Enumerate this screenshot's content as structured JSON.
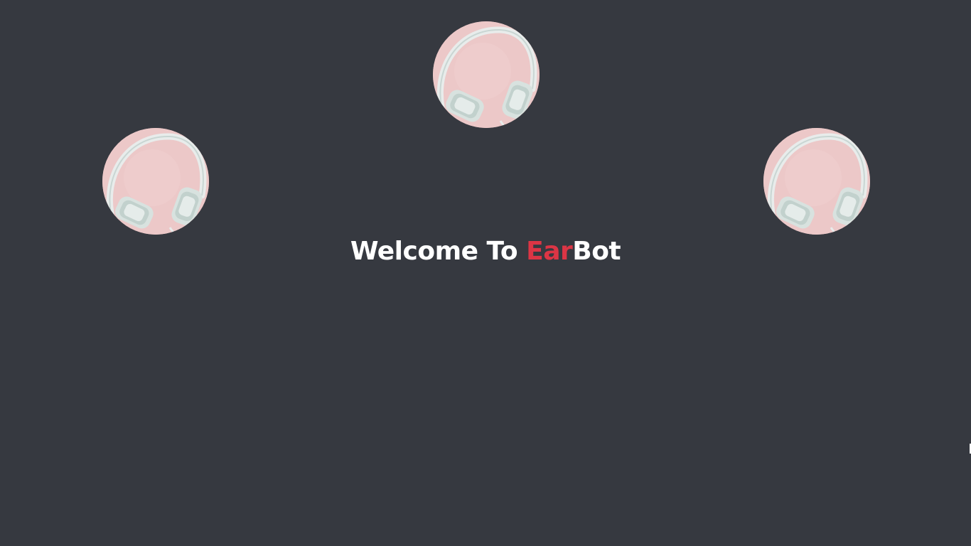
{
  "welcome": {
    "prefix": "Welcome To ",
    "brand_accent": "Ear",
    "brand_rest": "Bot"
  },
  "images": [
    {
      "icon": "headphones-image",
      "background": "#ecc8c8"
    },
    {
      "icon": "headphones-image",
      "background": "#ecc8c8"
    },
    {
      "icon": "headphones-image",
      "background": "#ecc8c8"
    }
  ],
  "colors": {
    "background": "#363940",
    "text": "#ffffff",
    "accent": "#dc3545"
  }
}
